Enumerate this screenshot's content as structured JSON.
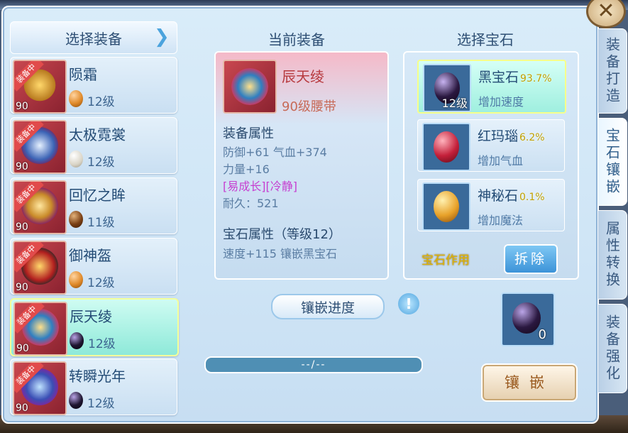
{
  "tabs": {
    "forge": "装备打造",
    "inlay": "宝石镶嵌",
    "convert": "属性转换",
    "enhance": "装备强化"
  },
  "left": {
    "header": "选择装备",
    "items": [
      {
        "name": "陨霜",
        "gem_level": "12级",
        "level": "90",
        "tag": "装备中",
        "gem_color": "#e08a2a"
      },
      {
        "name": "太极霓裳",
        "gem_level": "12级",
        "level": "90",
        "tag": "装备中",
        "gem_color": "#d9d4c6"
      },
      {
        "name": "回忆之眸",
        "gem_level": "11级",
        "level": "90",
        "tag": "装备中",
        "gem_color": "#7a3f13"
      },
      {
        "name": "御神盔",
        "gem_level": "12级",
        "level": "90",
        "tag": "装备中",
        "gem_color": "#e08a2a"
      },
      {
        "name": "辰天绫",
        "gem_level": "12级",
        "level": "90",
        "tag": "装备中",
        "gem_color": "#1e1530"
      },
      {
        "name": "转瞬光年",
        "gem_level": "12级",
        "level": "90",
        "tag": "装备中",
        "gem_color": "#1e1530"
      }
    ]
  },
  "current": {
    "title": "当前装备",
    "name": "辰天绫",
    "sub": "90级腰带",
    "attr_title": "装备属性",
    "attr1": "防御+61 气血+374",
    "attr2": "力量+16",
    "attr3": "[易成长][冷静]",
    "attr4": "耐久：521",
    "gem_attr_title": "宝石属性（等级12）",
    "gem_attr": "速度+115 镶嵌黑宝石"
  },
  "progress": {
    "label": "镶嵌进度",
    "text": "--/--",
    "fill": 0.0
  },
  "gems": {
    "title": "选择宝石",
    "items": [
      {
        "name": "黑宝石",
        "rate": "93.7%",
        "desc": "增加速度",
        "count": "12级",
        "color": "#2a1840"
      },
      {
        "name": "红玛瑙",
        "rate": "6.2%",
        "desc": "增加气血",
        "count": "",
        "color": "#c4203a"
      },
      {
        "name": "神秘石",
        "rate": "0.1%",
        "desc": "增加魔法",
        "count": "",
        "color": "#e8a22a"
      }
    ],
    "effect": "宝石作用",
    "remove": "拆除"
  },
  "slot": {
    "count": "0"
  },
  "inlay_button": "镶嵌",
  "icons": {
    "close": "close-icon",
    "info": "info-icon",
    "arrow": "scroll-arrow-icon"
  }
}
